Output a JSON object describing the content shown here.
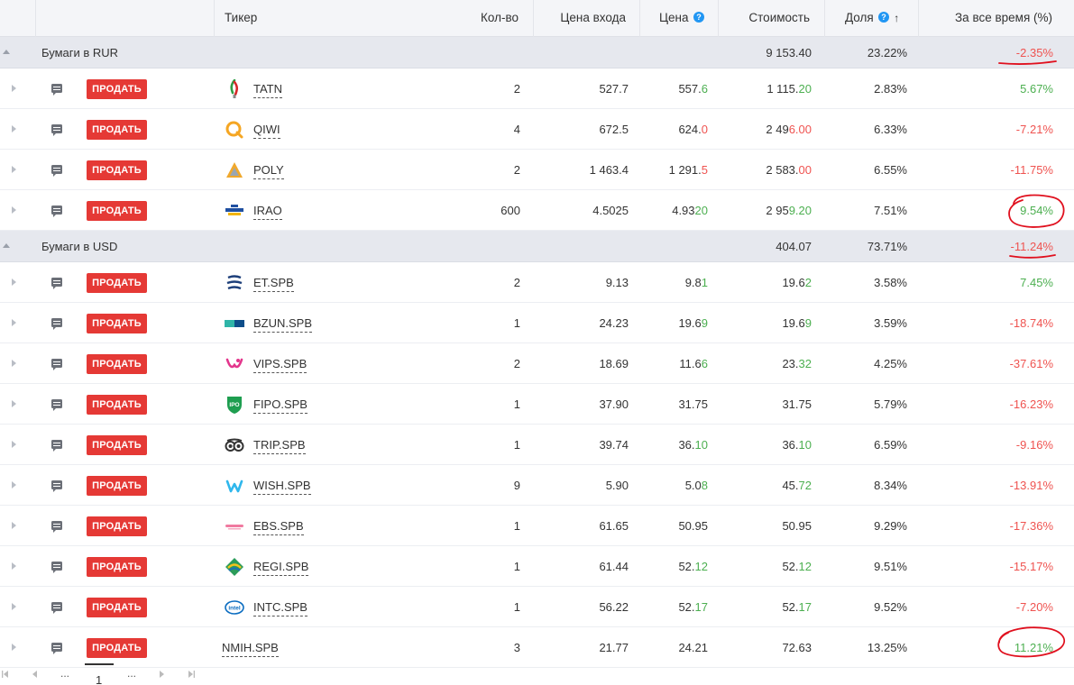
{
  "colors": {
    "sell": "#e53935",
    "positive": "#4caf50",
    "negative": "#ef5350",
    "annotation": "#e0101e"
  },
  "header": {
    "ticker": "Тикер",
    "qty": "Кол-во",
    "entry": "Цена входа",
    "price": "Цена",
    "value": "Стоимость",
    "share": "Доля",
    "total": "За все время (%)",
    "help_icon": "question-circle-icon",
    "sort_icon": "arrow-up-icon",
    "help_glyph": "?",
    "sort_glyph": "↑"
  },
  "sell_label": "ПРОДАТЬ",
  "groups": [
    {
      "name": "Бумаги в RUR",
      "value": "9 153.40",
      "share": "23.22%",
      "total": "-2.35%"
    },
    {
      "name": "Бумаги в USD",
      "value": "404.07",
      "share": "73.71%",
      "total": "-11.24%"
    }
  ],
  "rows": [
    {
      "ticker": "TATN",
      "logo": "tatneft-logo",
      "qty": "2",
      "entry": "527.7",
      "price_pre": "557.",
      "price_post": "6",
      "price_sign": "pos",
      "value_pre": "1 115.",
      "value_post": "20",
      "value_sign": "pos",
      "share": "2.83%",
      "total": "5.67%",
      "total_sign": "pos"
    },
    {
      "ticker": "QIWI",
      "logo": "qiwi-logo",
      "qty": "4",
      "entry": "672.5",
      "price_pre": "624.",
      "price_post": "0",
      "price_sign": "neg",
      "value_pre": "2 49",
      "value_post": "6.00",
      "value_sign": "neg",
      "share": "6.33%",
      "total": "-7.21%",
      "total_sign": "neg"
    },
    {
      "ticker": "POLY",
      "logo": "polymetal-logo",
      "qty": "2",
      "entry": "1 463.4",
      "price_pre": "1 291.",
      "price_post": "5",
      "price_sign": "neg",
      "value_pre": "2 583.",
      "value_post": "00",
      "value_sign": "neg",
      "share": "6.55%",
      "total": "-11.75%",
      "total_sign": "neg"
    },
    {
      "ticker": "IRAO",
      "logo": "interrao-logo",
      "qty": "600",
      "entry": "4.5025",
      "price_pre": "4.93",
      "price_post": "20",
      "price_sign": "pos",
      "value_pre": "2 95",
      "value_post": "9.20",
      "value_sign": "pos",
      "share": "7.51%",
      "total": "9.54%",
      "total_sign": "pos"
    },
    {
      "ticker": "ET.SPB",
      "logo": "energy-transfer-logo",
      "qty": "2",
      "entry": "9.13",
      "price_pre": "9.8",
      "price_post": "1",
      "price_sign": "pos",
      "value_pre": "19.6",
      "value_post": "2",
      "value_sign": "pos",
      "share": "3.58%",
      "total": "7.45%",
      "total_sign": "pos"
    },
    {
      "ticker": "BZUN.SPB",
      "logo": "baozun-logo",
      "qty": "1",
      "entry": "24.23",
      "price_pre": "19.6",
      "price_post": "9",
      "price_sign": "pos",
      "value_pre": "19.6",
      "value_post": "9",
      "value_sign": "pos",
      "share": "3.59%",
      "total": "-18.74%",
      "total_sign": "neg"
    },
    {
      "ticker": "VIPS.SPB",
      "logo": "vipshop-logo",
      "qty": "2",
      "entry": "18.69",
      "price_pre": "11.6",
      "price_post": "6",
      "price_sign": "pos",
      "value_pre": "23.",
      "value_post": "32",
      "value_sign": "pos",
      "share": "4.25%",
      "total": "-37.61%",
      "total_sign": "neg"
    },
    {
      "ticker": "FIPO.SPB",
      "logo": "ipo-shield-logo",
      "logo_text": "IPO",
      "qty": "1",
      "entry": "37.90",
      "price_pre": "31.75",
      "price_post": "",
      "price_sign": "pos",
      "value_pre": "31.75",
      "value_post": "",
      "value_sign": "pos",
      "share": "5.79%",
      "total": "-16.23%",
      "total_sign": "neg"
    },
    {
      "ticker": "TRIP.SPB",
      "logo": "tripadvisor-logo",
      "qty": "1",
      "entry": "39.74",
      "price_pre": "36.",
      "price_post": "10",
      "price_sign": "pos",
      "value_pre": "36.",
      "value_post": "10",
      "value_sign": "pos",
      "share": "6.59%",
      "total": "-9.16%",
      "total_sign": "neg"
    },
    {
      "ticker": "WISH.SPB",
      "logo": "wish-logo",
      "qty": "9",
      "entry": "5.90",
      "price_pre": "5.0",
      "price_post": "8",
      "price_sign": "pos",
      "value_pre": "45.",
      "value_post": "72",
      "value_sign": "pos",
      "share": "8.34%",
      "total": "-13.91%",
      "total_sign": "neg"
    },
    {
      "ticker": "EBS.SPB",
      "logo": "emergent-logo",
      "qty": "1",
      "entry": "61.65",
      "price_pre": "50.95",
      "price_post": "",
      "price_sign": "pos",
      "value_pre": "50.95",
      "value_post": "",
      "value_sign": "pos",
      "share": "9.29%",
      "total": "-17.36%",
      "total_sign": "neg"
    },
    {
      "ticker": "REGI.SPB",
      "logo": "regi-logo",
      "qty": "1",
      "entry": "61.44",
      "price_pre": "52.",
      "price_post": "12",
      "price_sign": "pos",
      "value_pre": "52.",
      "value_post": "12",
      "value_sign": "pos",
      "share": "9.51%",
      "total": "-15.17%",
      "total_sign": "neg"
    },
    {
      "ticker": "INTC.SPB",
      "logo": "intel-logo",
      "logo_text": "intel",
      "qty": "1",
      "entry": "56.22",
      "price_pre": "52.",
      "price_post": "17",
      "price_sign": "pos",
      "value_pre": "52.",
      "value_post": "17",
      "value_sign": "pos",
      "share": "9.52%",
      "total": "-7.20%",
      "total_sign": "neg"
    },
    {
      "ticker": "NMIH.SPB",
      "logo": "",
      "qty": "3",
      "entry": "21.77",
      "price_pre": "24.21",
      "price_post": "",
      "price_sign": "pos",
      "value_pre": "72.63",
      "value_post": "",
      "value_sign": "pos",
      "share": "13.25%",
      "total": "11.21%",
      "total_sign": "pos"
    }
  ],
  "pager": {
    "dots_left": "...",
    "current": "1",
    "dots_right": "..."
  }
}
